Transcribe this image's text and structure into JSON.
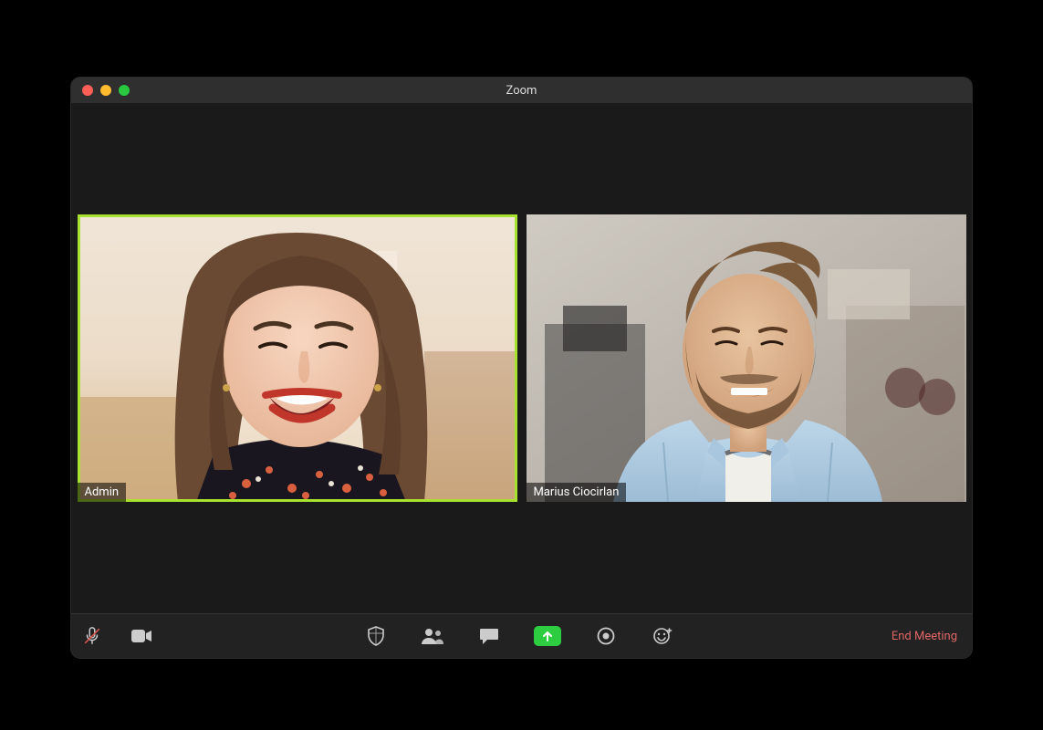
{
  "window": {
    "title": "Zoom"
  },
  "participants": [
    {
      "name": "Admin",
      "is_speaking": true
    },
    {
      "name": "Marius Ciocirlan",
      "is_speaking": false
    }
  ],
  "toolbar": {
    "mute_label": "Mute",
    "video_label": "Stop Video",
    "security_label": "Security",
    "participants_label": "Participants",
    "chat_label": "Chat",
    "share_label": "Share Screen",
    "record_label": "Record",
    "reactions_label": "Reactions",
    "end_label": "End Meeting"
  },
  "colors": {
    "speaking_border": "#a6e22e",
    "share_green": "#2ecc40",
    "end_red": "#e06666"
  }
}
